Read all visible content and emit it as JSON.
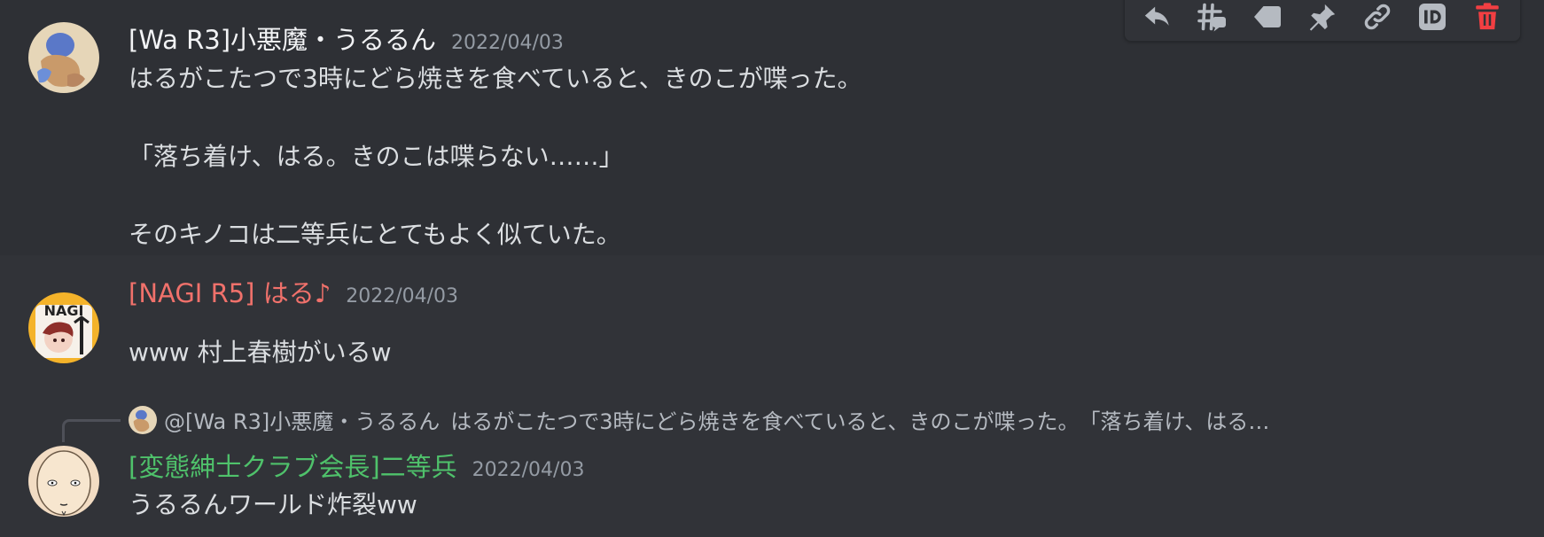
{
  "toolbar": {
    "items": [
      {
        "icon": "reply-icon",
        "color": "#b5bac1"
      },
      {
        "icon": "thread-icon",
        "color": "#b5bac1"
      },
      {
        "icon": "tag-icon",
        "color": "#b5bac1"
      },
      {
        "icon": "pin-icon",
        "color": "#b5bac1"
      },
      {
        "icon": "link-icon",
        "color": "#b5bac1"
      },
      {
        "icon": "copy-id-icon",
        "color": "#b5bac1"
      },
      {
        "icon": "delete-icon",
        "color": "#f23f42"
      }
    ]
  },
  "messages": [
    {
      "author": "[Wa R3]小悪魔・うるるん",
      "author_color": "#f2f3f5",
      "timestamp": "2022/04/03",
      "lines": [
        "はるがこたつで3時にどら焼きを食べていると、きのこが喋った。",
        "",
        "「落ち着け、はる。きのこは喋らない……」",
        "",
        "そのキノコは二等兵にとてもよく似ていた。"
      ]
    },
    {
      "author": "[NAGI R5] はる♪",
      "author_color": "#f0716b",
      "timestamp": "2022/04/03",
      "lines": [
        "www 村上春樹がいるw"
      ],
      "avatar_text": "NAGI"
    },
    {
      "author": "[変態紳士クラブ会長]二等兵",
      "author_color": "#4fc26b",
      "timestamp": "2022/04/03",
      "lines": [
        "うるるんワールド炸裂ww"
      ],
      "reply": {
        "author": "@[Wa R3]小悪魔・うるるん",
        "preview": "はるがこたつで3時にどら焼きを食べていると、きのこが喋った。　「落ち着け、はる…"
      }
    }
  ]
}
